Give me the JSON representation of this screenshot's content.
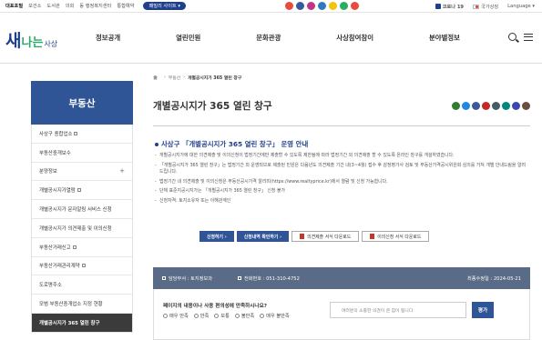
{
  "topbar": {
    "links": [
      "대표포털",
      "보건소",
      "도서관",
      "의회",
      "동 행정복지센터",
      "통합예약"
    ],
    "sites_label": "패밀리 사이트 ▾",
    "sns_colors": [
      "#e94b3c",
      "#3b5998",
      "#c13584",
      "#2c7bbf",
      "#f1c40f",
      "#27ae60",
      "#e74c3c"
    ],
    "complaint": "코로나 19",
    "national": "국가상징",
    "language": "Language ▾"
  },
  "header": {
    "logo_main": "새",
    "logo_na": "나는",
    "logo_sa": "사상",
    "gnb": [
      "정보공개",
      "열린민원",
      "문화관광",
      "사상참여참이",
      "분야별정보"
    ]
  },
  "sidebar": {
    "title": "부동산",
    "items": [
      {
        "label": "사상구 종합업소",
        "ext": true,
        "plus": false,
        "active": false
      },
      {
        "label": "부동산중개보수",
        "ext": false,
        "plus": false,
        "active": false
      },
      {
        "label": "분양정보",
        "ext": false,
        "plus": true,
        "active": false
      },
      {
        "label": "개별공시지가열람",
        "ext": true,
        "plus": false,
        "active": false
      },
      {
        "label": "개별공시지가 문자알림 서비스 신청",
        "ext": false,
        "plus": false,
        "active": false
      },
      {
        "label": "개별공시지가 의견제출 및 이의신청",
        "ext": false,
        "plus": false,
        "active": false
      },
      {
        "label": "부동산거래신고",
        "ext": true,
        "plus": false,
        "active": false
      },
      {
        "label": "부동산거래관리계약",
        "ext": true,
        "plus": false,
        "active": false
      },
      {
        "label": "도로명주소",
        "ext": false,
        "plus": false,
        "active": false
      },
      {
        "label": "모범 부동산중개업소 지정 현황",
        "ext": false,
        "plus": false,
        "active": false
      },
      {
        "label": "개별공시지가 365 열린 창구",
        "ext": false,
        "plus": false,
        "active": true
      }
    ]
  },
  "breadcrumb": {
    "items": [
      "부동산",
      "개별공시지가 365 열린 창구"
    ]
  },
  "page": {
    "title": "개별공시지가 365 열린 창구",
    "share_colors": [
      "#2e7d32",
      "#1e88e5",
      "#3b5998",
      "#c62828",
      "#455a64",
      "#00897b",
      "#3949ab",
      "#6d4c41"
    ]
  },
  "notice": {
    "heading": "사상구 「개별공시지가 365 열린 창구」 운영 안내",
    "items": [
      "개별공시지가에 대한 의견제출 및 이의신청이 법정기간에만 제출할 수 있도록 제한됨에 따라 법정기간 외 의견제출 할 수 있도록 온라인 창구를 개설하였습니다.",
      "「개별공시지가 365 열린 창구」는 법정기간 외 운영되므로 제출된 민원은 다음년도 의견제출 기간 내(3~4월) 접수 후 감정평가사 검토 및 부동산가격공시위원회 심의를 거쳐 개별 안내드림을 알려드립니다.",
      "법정기간 내 의견제출 및 이의신청은 부동산공시가격 알리미(https://www.realtyprice.kr)에서 열람 및 신청 가능합니다.",
      "단체 표준지공시지가는 「개별공시지가 365 열린 창구」 신청 불가",
      "신청자격: 토지소유자 또는 이해관계인"
    ]
  },
  "buttons": {
    "apply": "신청하기 ›",
    "check": "신청내역 확인하기 ›",
    "form1": "의견제출 서식 다운로드",
    "form2": "이의신청 서식 다운로드"
  },
  "info": {
    "dept": "담당부서 : 토지정보과",
    "phone": "전화번호 : 051-310-4752",
    "updated": "최종수정일 : 2024-05-21"
  },
  "survey": {
    "question": "페이지의 내용이나 사용 편의성에 만족하시나요?",
    "options": [
      "매우 만족",
      "만족",
      "보통",
      "불만족",
      "매우 불만족"
    ],
    "placeholder": "여러분의 소중한 의견이 큰 힘이 됩니다.",
    "submit": "평가"
  }
}
